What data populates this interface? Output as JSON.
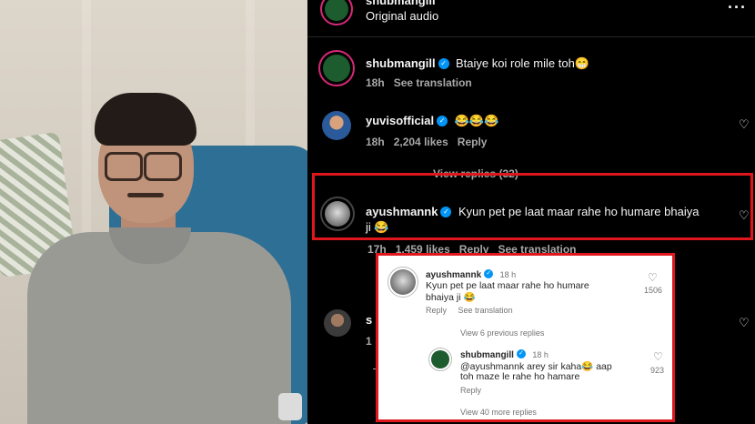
{
  "header": {
    "username_partial": "shubmangill",
    "audio_label": "Original audio",
    "more_icon": "more-dots-icon"
  },
  "comments": [
    {
      "username": "shubmangill",
      "text": "Btaiye koi role mile toh😁",
      "time": "18h",
      "action": "See translation"
    },
    {
      "username": "yuvisofficial",
      "text": "😂😂😂",
      "time": "18h",
      "likes": "2,204 likes",
      "action": "Reply",
      "view_replies": "View replies (32)"
    },
    {
      "username": "ayushmannk",
      "text_line1": "Kyun pet pe laat maar rahe ho humare bhaiya",
      "text_line2": "ji 😂",
      "time": "17h",
      "likes": "1,459 likes",
      "action1": "Reply",
      "action2": "See translation"
    },
    {
      "username_partial": "s",
      "time_partial": "1"
    }
  ],
  "zoom_popup": {
    "comment": {
      "username": "ayushmannk",
      "time": "18 h",
      "text_line1": "Kyun pet pe laat maar rahe ho humare",
      "text_line2": "bhaiya ji 😂",
      "reply": "Reply",
      "see_translation": "See translation",
      "likes": "1506"
    },
    "view_previous": "View 6 previous replies",
    "reply": {
      "username": "shubmangill",
      "time": "18 h",
      "text_line1": "@ayushmannk arey sir kaha😂 aap",
      "text_line2": "toh maze le rahe ho hamare",
      "reply": "Reply",
      "likes": "923"
    },
    "view_more": "View 40 more replies"
  },
  "colors": {
    "highlight": "#e0161d",
    "verified": "#0095f6",
    "story_ring": "#d62976"
  }
}
